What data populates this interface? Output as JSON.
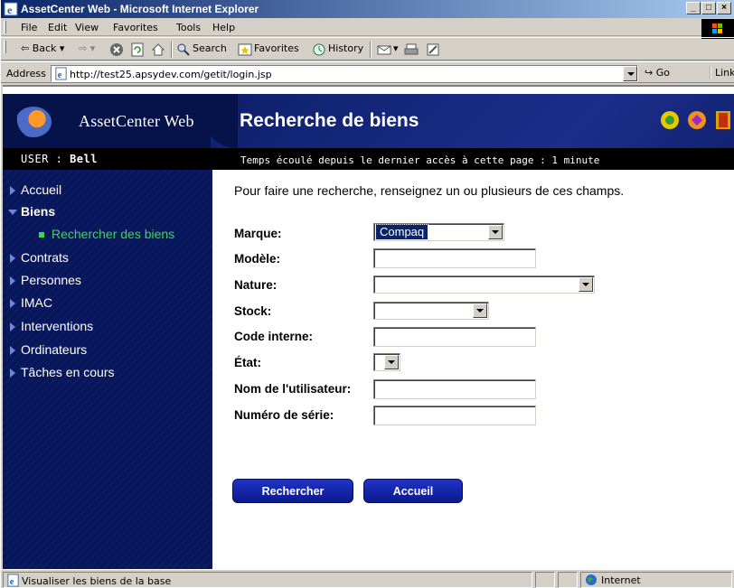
{
  "browser": {
    "title": "AssetCenter Web - Microsoft Internet Explorer",
    "menu": [
      "File",
      "Edit",
      "View",
      "Favorites",
      "Tools",
      "Help"
    ],
    "toolbar": {
      "back": "Back",
      "search": "Search",
      "favorites": "Favorites",
      "history": "History"
    },
    "address_label": "Address",
    "url": "http://test25.apsydev.com/getit/login.jsp",
    "go_label": "Go",
    "links_label": "Links",
    "status_text": "Visualiser les biens de la base",
    "zone": "Internet"
  },
  "app": {
    "brand": "AssetCenter Web",
    "page_title": "Recherche de biens",
    "user_label": "USER : ",
    "user_name": "Bell",
    "elapsed": "Temps écoulé depuis le dernier accès à cette page : 1 minute"
  },
  "sidebar": {
    "items": [
      {
        "label": "Accueil"
      },
      {
        "label": "Biens"
      },
      {
        "label": "Rechercher des biens"
      },
      {
        "label": "Contrats"
      },
      {
        "label": "Personnes"
      },
      {
        "label": "IMAC"
      },
      {
        "label": "Interventions"
      },
      {
        "label": "Ordinateurs"
      },
      {
        "label": "Tâches en cours"
      }
    ]
  },
  "form": {
    "intro": "Pour faire une recherche, renseignez un ou plusieurs de ces champs.",
    "fields": {
      "marque": {
        "label": "Marque:",
        "value": "Compaq"
      },
      "modele": {
        "label": "Modèle:",
        "value": ""
      },
      "nature": {
        "label": "Nature:",
        "value": ""
      },
      "stock": {
        "label": "Stock:",
        "value": ""
      },
      "code_interne": {
        "label": "Code interne:",
        "value": ""
      },
      "etat": {
        "label": "État:",
        "value": ""
      },
      "utilisateur": {
        "label": "Nom de l'utilisateur:",
        "value": ""
      },
      "serie": {
        "label": "Numéro de série:",
        "value": ""
      }
    },
    "buttons": {
      "search": "Rechercher",
      "home": "Accueil"
    }
  },
  "colors": {
    "nav_bg": "#08175c",
    "active_sub": "#3fd64f",
    "button": "#1f33c7"
  }
}
